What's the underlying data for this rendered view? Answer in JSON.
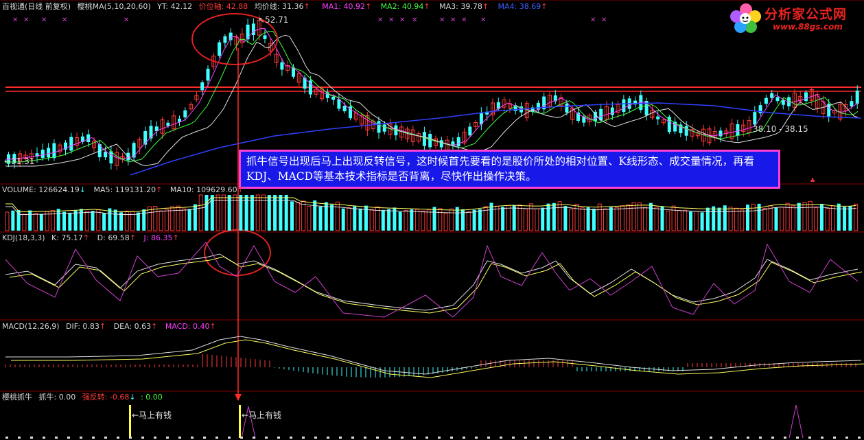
{
  "main_panel": {
    "title": "百视通(日线 前复权)",
    "ma_group": "樱桃MA(5,10,20,60)",
    "yt": "YT: 42.12",
    "price_axis": "价位轴: 42.88",
    "avg_line": "均价线: 31.36",
    "ma1": "MA1: 40.92",
    "ma2": "MA2: 40.94",
    "ma3": "MA3: 39.78",
    "ma4": "MA4: 38.69",
    "peak_label": "52.71",
    "low_label": "31.31",
    "range_label": "38.10 - 38.15",
    "arrow_low": "←"
  },
  "volume_panel": {
    "volume": "VOLUME: 126624.19",
    "ma5": "MA5: 119131.20",
    "ma10": "MA10: 109629.60"
  },
  "kdj_panel": {
    "title": "KDJ(18,3,3)",
    "k": "K: 75.17",
    "d": "D: 69.58",
    "j": "J: 86.35"
  },
  "macd_panel": {
    "title": "MACD(12,26,9)",
    "dif": "DIF: 0.83",
    "dea": "DEA: 0.63",
    "macd": "MACD: 0.40"
  },
  "signal_panel": {
    "title": "樱桃抓牛",
    "grab": "抓牛: 0.00",
    "reversal": "强反转: -0.68",
    "extra": ": 0.00",
    "flag1": "←马上有钱",
    "flag2": "←马上有钱"
  },
  "annotation": "抓牛信号出现后马上出现反转信号，这时候首先要看的是股价所处的相对位置、K线形态、成交量情况，再看KDJ、MACD等基本技术指标是否背离，尽快作出操作决策。",
  "logo": {
    "name": "分析家公式网",
    "url": "www.88gs.com"
  },
  "colors": {
    "up": "#ff3a3a",
    "down": "#40ffff",
    "ma1": "#ff40ff",
    "ma2": "#40ff40",
    "ma3": "#d0d0d0",
    "ma4": "#3040ff",
    "annotation_bg": "#1818e8",
    "annotation_border": "#ff40d8"
  }
}
